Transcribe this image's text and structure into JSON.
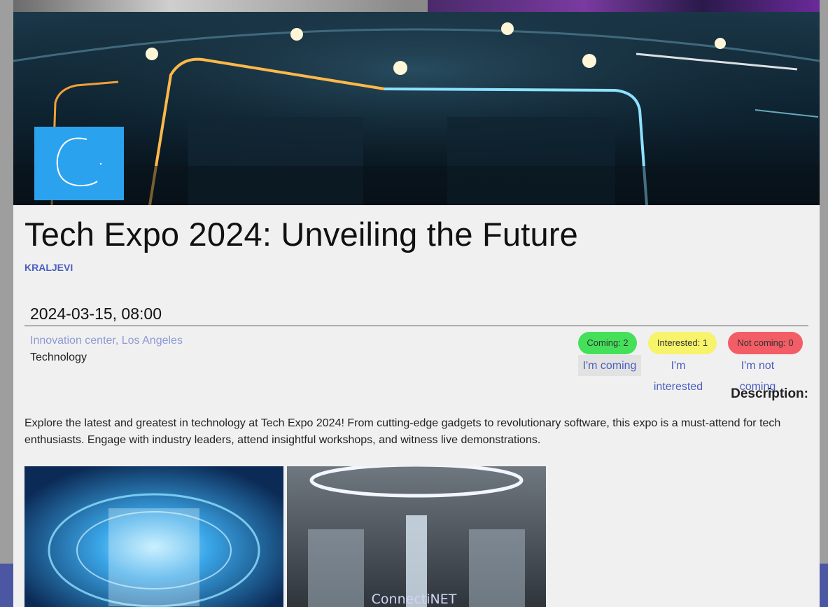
{
  "event": {
    "title": "Tech Expo 2024: Unveiling the Future",
    "organizer": "KRALJEVI",
    "datetime": "2024-03-15, 08:00",
    "location": "Innovation center, Los Angeles",
    "category": "Technology",
    "description_label": "Description:",
    "description": "Explore the latest and greatest in technology at Tech Expo 2024! From cutting-edge gadgets to revolutionary software, this expo is a must-attend for tech enthusiasts. Engage with industry leaders, attend insightful workshops, and witness live demonstrations."
  },
  "rsvp": {
    "counts": {
      "coming": "Coming: 2",
      "interested": "Interested: 1",
      "not_coming": "Not coming: 0"
    },
    "actions": {
      "coming": "I'm coming",
      "interested": "I'm interested",
      "not_coming": "I'm not coming"
    }
  },
  "footer": {
    "brand": "ConnectiNET"
  },
  "colors": {
    "accent": "#4b5fc0",
    "coming": "#44e05a",
    "interested": "#f7f36a",
    "not_coming": "#f25d66",
    "footer_bar": "#4b57a3",
    "logo_bg": "#2ba2ee"
  },
  "icons": {
    "logo": "c-letter-logo-icon"
  }
}
